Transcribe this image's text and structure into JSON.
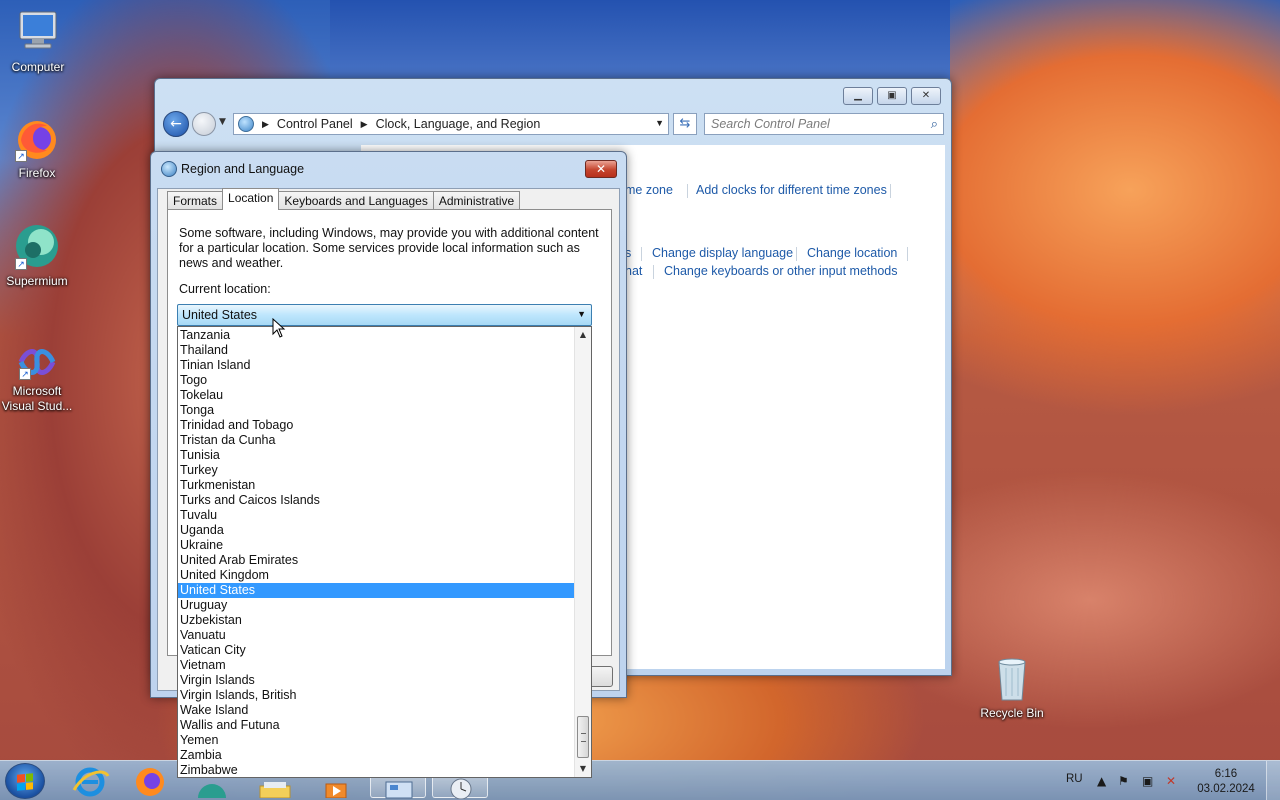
{
  "desktop": {
    "icons": [
      {
        "label": "Computer"
      },
      {
        "label": "Firefox"
      },
      {
        "label": "Supermium"
      },
      {
        "label": "Microsoft Visual Stud..."
      },
      {
        "label": "Recycle Bin"
      }
    ]
  },
  "control_panel": {
    "breadcrumb": [
      "Control Panel",
      "Clock, Language, and Region"
    ],
    "search_placeholder": "Search Control Panel",
    "links": {
      "time_zone_partial": "me zone",
      "add_clocks": "Add clocks for different time zones",
      "partial_s": "s",
      "change_display_language": "Change display language",
      "change_location": "Change location",
      "partial_nat": "nat",
      "change_keyboards": "Change keyboards or other input methods"
    }
  },
  "dialog": {
    "title": "Region and Language",
    "tabs": [
      "Formats",
      "Location",
      "Keyboards and Languages",
      "Administrative"
    ],
    "active_tab": "Location",
    "description": "Some software, including Windows, may provide you with additional content for a particular location. Some services provide local information such as news and weather.",
    "current_location_label": "Current location:",
    "current_location_value": "United States",
    "location_options": [
      "Tanzania",
      "Thailand",
      "Tinian Island",
      "Togo",
      "Tokelau",
      "Tonga",
      "Trinidad and Tobago",
      "Tristan da Cunha",
      "Tunisia",
      "Turkey",
      "Turkmenistan",
      "Turks and Caicos Islands",
      "Tuvalu",
      "Uganda",
      "Ukraine",
      "United Arab Emirates",
      "United Kingdom",
      "United States",
      "Uruguay",
      "Uzbekistan",
      "Vanuatu",
      "Vatican City",
      "Vietnam",
      "Virgin Islands",
      "Virgin Islands, British",
      "Wake Island",
      "Wallis and Futuna",
      "Yemen",
      "Zambia",
      "Zimbabwe"
    ],
    "selected_option": "United States"
  },
  "taskbar": {
    "language": "RU",
    "time": "6:16",
    "date": "03.02.2024"
  },
  "colors": {
    "selection": "#3399ff",
    "link": "#1e5aa8"
  }
}
